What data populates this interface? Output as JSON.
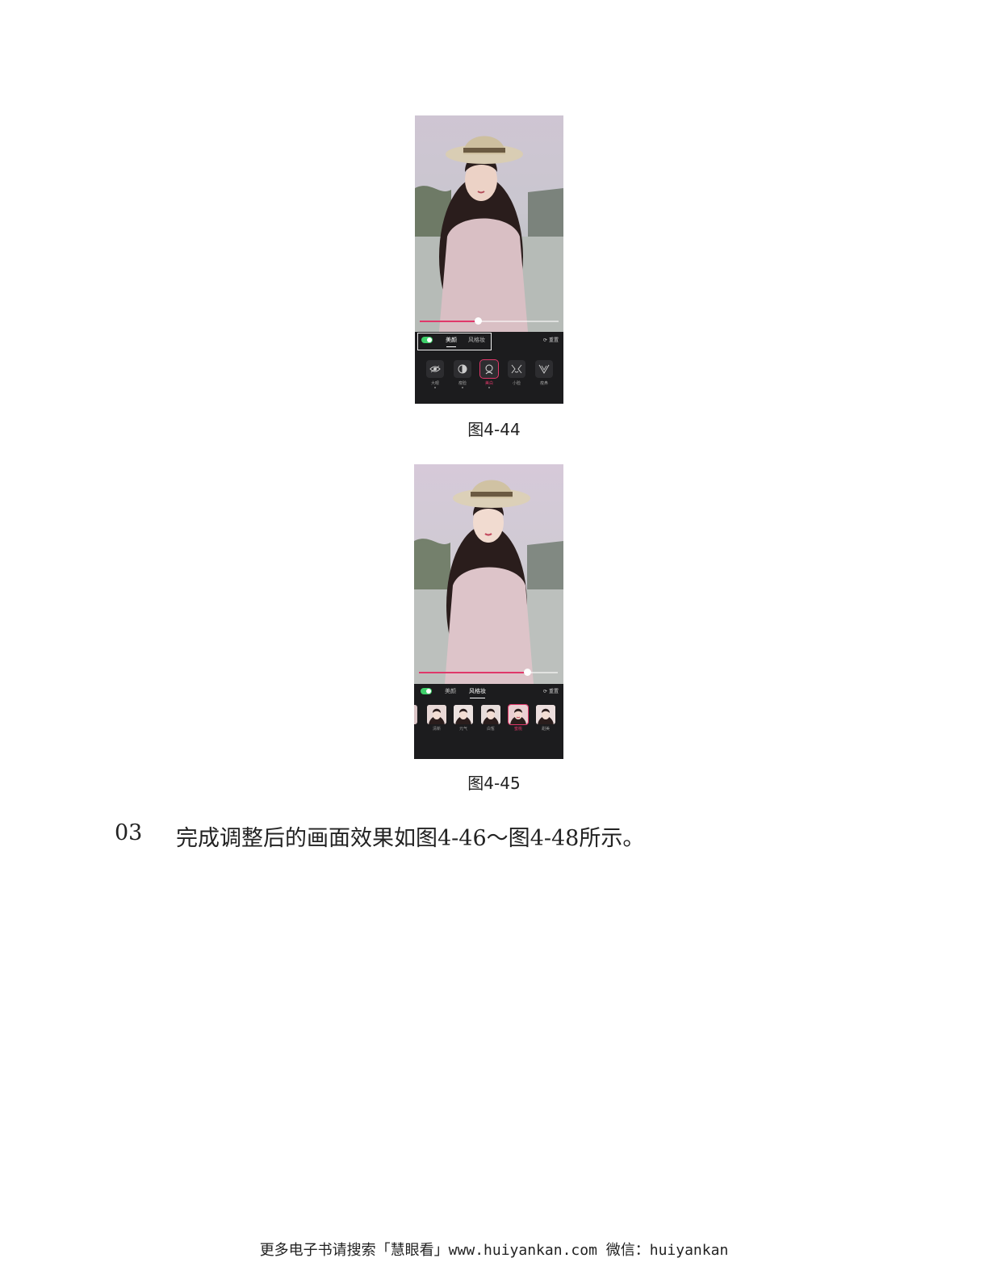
{
  "figures": [
    {
      "caption": "图4-44",
      "slider_value": 0.42,
      "panel": {
        "tabs": [
          "美颜",
          "风格妆"
        ],
        "active_tab": 0,
        "reset_label": "重置",
        "tools": [
          {
            "label": "大眼",
            "icon": "eye-icon"
          },
          {
            "label": "瘦脸",
            "icon": "face-contour-icon"
          },
          {
            "label": "美白",
            "icon": "face-icon",
            "selected": true
          },
          {
            "label": "小脸",
            "icon": "small-face-icon"
          },
          {
            "label": "瘦鼻",
            "icon": "v-face-icon"
          }
        ]
      }
    },
    {
      "caption": "图4-45",
      "slider_value": 0.78,
      "panel": {
        "tabs": [
          "美颜",
          "风格妆"
        ],
        "active_tab": 1,
        "reset_label": "重置",
        "styles": [
          {
            "label": "清新"
          },
          {
            "label": "元气"
          },
          {
            "label": "白皙"
          },
          {
            "label": "蜜桃",
            "selected": true
          },
          {
            "label": "甜美"
          }
        ]
      }
    }
  ],
  "step": {
    "number": "03",
    "text": "完成调整后的画面效果如图4-46～图4-48所示。"
  },
  "footer": "更多电子书请搜索「慧眼看」www.huiyankan.com  微信：huiyankan",
  "colors": {
    "accent": "#e0386a",
    "toggle": "#3ecf6a",
    "panel_bg": "#1c1c1e"
  }
}
